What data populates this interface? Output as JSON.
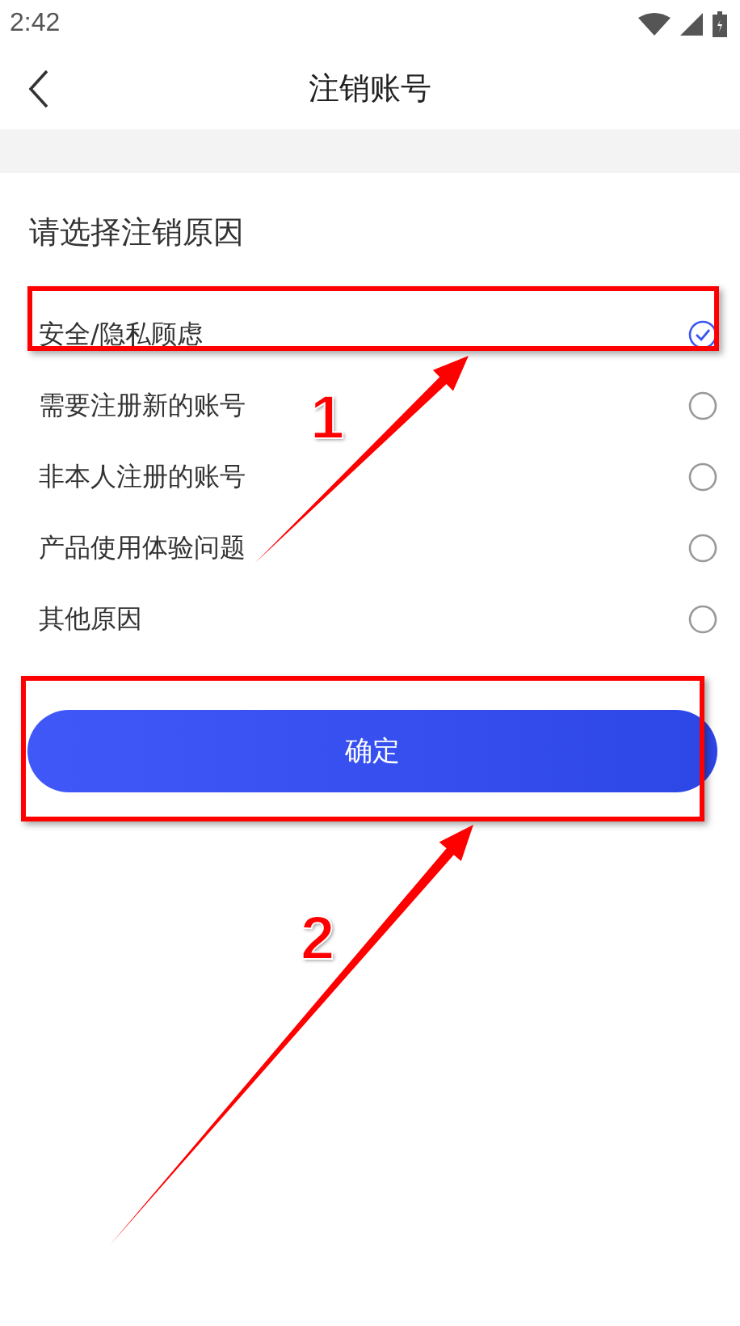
{
  "status_bar": {
    "time": "2:42"
  },
  "header": {
    "title": "注销账号"
  },
  "section_title": "请选择注销原因",
  "reasons": [
    {
      "label": "安全/隐私顾虑",
      "selected": true
    },
    {
      "label": "需要注册新的账号",
      "selected": false
    },
    {
      "label": "非本人注册的账号",
      "selected": false
    },
    {
      "label": "产品使用体验问题",
      "selected": false
    },
    {
      "label": "其他原因",
      "selected": false
    }
  ],
  "confirm_button": "确定",
  "annotations": [
    {
      "label": "1"
    },
    {
      "label": "2"
    }
  ]
}
